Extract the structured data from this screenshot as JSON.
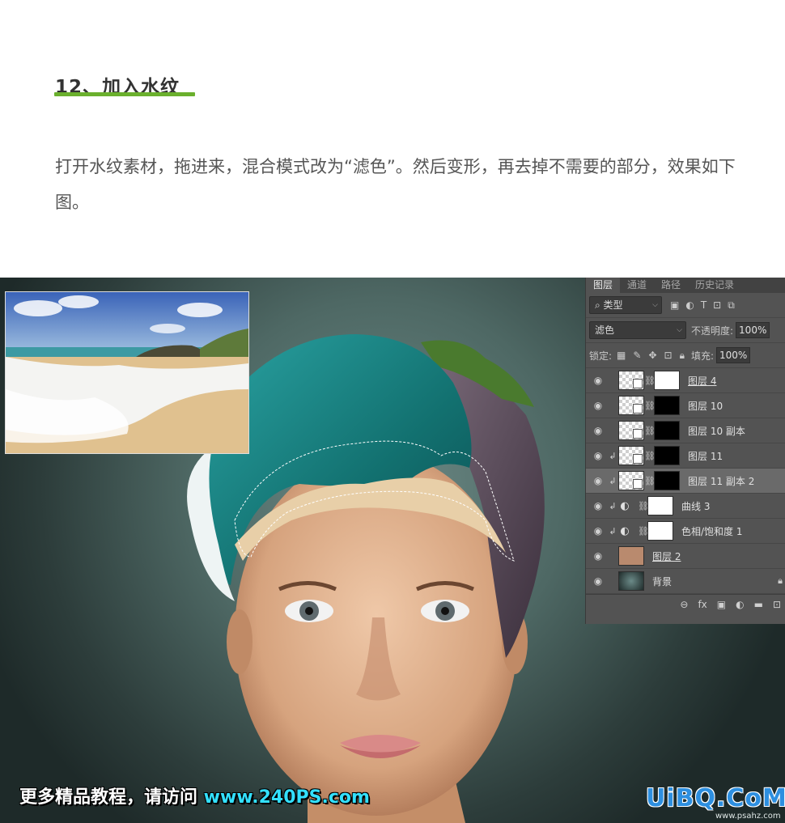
{
  "article": {
    "heading": "12、加入水纹",
    "paragraph": "打开水纹素材，拖进来，混合模式改为“滤色”。然后变形，再去掉不需要的部分，效果如下图。",
    "underline_color": "#6ab02d"
  },
  "ps_panel": {
    "tabs": [
      "图层",
      "通道",
      "路径",
      "历史记录"
    ],
    "filter_label": "类型",
    "blend_mode": "滤色",
    "opacity_label": "不透明度:",
    "opacity_value": "100%",
    "lock_label": "锁定:",
    "fill_label": "填充:",
    "fill_value": "100%",
    "layers": [
      {
        "name": "图层 4",
        "mask": "black"
      },
      {
        "name": "图层 10",
        "mask": "black"
      },
      {
        "name": "图层 10 副本",
        "mask": "black"
      },
      {
        "name": "图层 11",
        "mask": "black"
      },
      {
        "name": "图层 11 副本 2",
        "mask": "black"
      },
      {
        "name": "曲线 3",
        "mask": "white"
      },
      {
        "name": "色相/饱和度 1",
        "mask": "white"
      },
      {
        "name": "图层 2"
      },
      {
        "name": "背景"
      }
    ]
  },
  "watermark": {
    "left_text": "更多精品教程，请访问 ",
    "left_url": "www.240PS.com",
    "right_logo": "UiBQ.CoM",
    "right_small": "www.psahz.com"
  }
}
